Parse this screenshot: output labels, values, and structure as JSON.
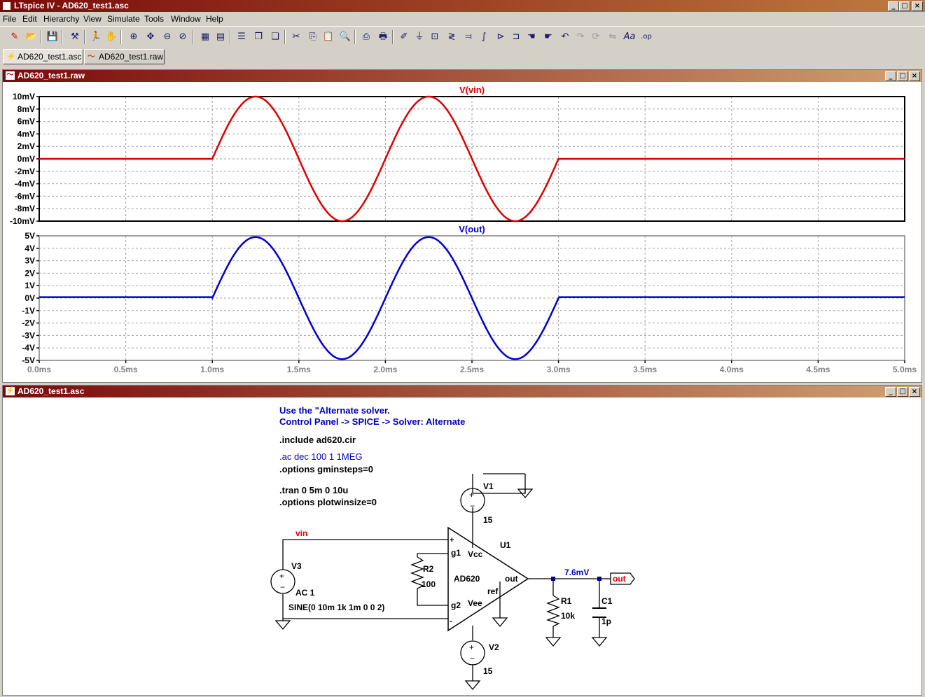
{
  "app": {
    "title": "LTspice IV - AD620_test1.asc"
  },
  "window_buttons": {
    "minimize": "_",
    "restore": "□",
    "close": "×"
  },
  "menu": [
    "File",
    "Edit",
    "Hierarchy",
    "View",
    "Simulate",
    "Tools",
    "Window",
    "Help"
  ],
  "tabs": [
    {
      "label": "AD620_test1.asc",
      "icon": "schematic-icon",
      "active": true
    },
    {
      "label": "AD620_test1.raw",
      "icon": "waveform-icon",
      "active": false
    }
  ],
  "waveform_window": {
    "title": "AD620_test1.raw"
  },
  "schematic_window": {
    "title": "AD620_test1.asc"
  },
  "colors": {
    "vin": "#e00000",
    "out": "#0000d0",
    "directive": "#0000c0",
    "component": "#000080"
  },
  "chart_data": [
    {
      "type": "line",
      "title": "V(vin)",
      "x_ticks": [
        "0.0ms",
        "0.5ms",
        "1.0ms",
        "1.5ms",
        "2.0ms",
        "2.5ms",
        "3.0ms",
        "3.5ms",
        "4.0ms",
        "4.5ms",
        "5.0ms"
      ],
      "y_ticks": [
        "10mV",
        "8mV",
        "6mV",
        "4mV",
        "2mV",
        "0mV",
        "-2mV",
        "-4mV",
        "-6mV",
        "-8mV",
        "-10mV"
      ],
      "xlim": [
        0,
        5
      ],
      "ylim": [
        -10,
        10
      ],
      "x_unit": "ms",
      "y_unit": "mV",
      "series": [
        {
          "name": "V(vin)",
          "function": "sine",
          "amplitude": 10,
          "frequency_khz": 1,
          "delay_ms": 1,
          "cycles": 2
        }
      ],
      "grid": true
    },
    {
      "type": "line",
      "title": "V(out)",
      "x_ticks": [
        "0.0ms",
        "0.5ms",
        "1.0ms",
        "1.5ms",
        "2.0ms",
        "2.5ms",
        "3.0ms",
        "3.5ms",
        "4.0ms",
        "4.5ms",
        "5.0ms"
      ],
      "y_ticks": [
        "5V",
        "4V",
        "3V",
        "2V",
        "1V",
        "0V",
        "-1V",
        "-2V",
        "-3V",
        "-4V",
        "-5V"
      ],
      "xlim": [
        0,
        5
      ],
      "ylim": [
        -5,
        5
      ],
      "x_unit": "ms",
      "y_unit": "V",
      "series": [
        {
          "name": "V(out)",
          "function": "sine",
          "amplitude": 4.9,
          "frequency_khz": 1,
          "delay_ms": 1,
          "cycles": 2,
          "offset": 0.08
        }
      ],
      "grid": true
    }
  ],
  "schematic": {
    "directives": {
      "comment1": "Use the \"Alternate solver.",
      "comment2": "Control Panel -> SPICE -> Solver: Alternate",
      "include": ".include ad620.cir",
      "ac": ".ac dec 100 1 1MEG",
      "options1": ".options gminsteps=0",
      "tran": ".tran 0 5m 0 10u",
      "options2": ".options plotwinsize=0"
    },
    "labels": {
      "v1": "V1",
      "v1_val": "15",
      "v2": "V2",
      "v2_val": "15",
      "v3": "V3",
      "v3_ac": "AC 1",
      "v3_sine": "SINE(0 10m 1k 1m 0 0 2)",
      "u1": "U1",
      "u1_model": "AD620",
      "pin_plus": "+",
      "pin_minus": "-",
      "pin_g1": "g1",
      "pin_g2": "g2",
      "pin_vcc": "Vcc",
      "pin_vee": "Vee",
      "pin_ref": "ref",
      "pin_out": "out",
      "r2": "R2",
      "r2_val": "100",
      "r1": "R1",
      "r1_val": "10k",
      "c1": "C1",
      "c1_val": "1p",
      "net_vin": "vin",
      "net_out": "out",
      "op_voltage": "7.6mV"
    }
  }
}
